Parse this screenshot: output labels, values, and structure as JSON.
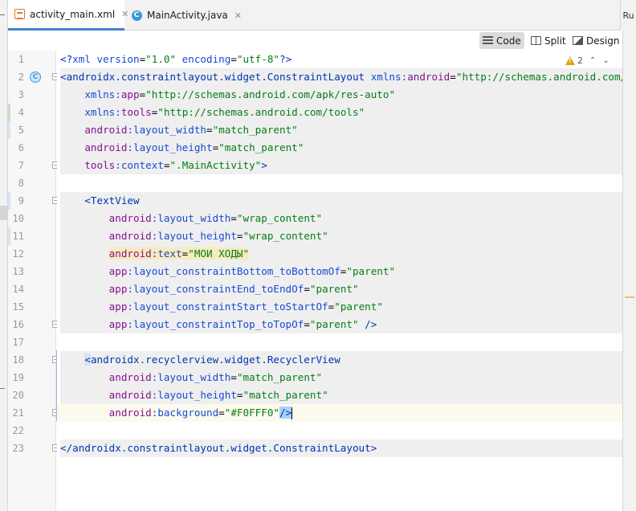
{
  "tabs": [
    {
      "label": "activity_main.xml",
      "icon": "xml-file-icon",
      "active": true,
      "close": "✕"
    },
    {
      "label": "MainActivity.java",
      "icon": "java-class-icon",
      "active": false,
      "close": "✕"
    }
  ],
  "right_strip_label": "Ru",
  "view_modes": {
    "code": "Code",
    "split": "Split",
    "design": "Design",
    "selected": "Code"
  },
  "inspection": {
    "warnings": "2"
  },
  "gutter_icon_letter": "C",
  "line_numbers": [
    "1",
    "2",
    "3",
    "4",
    "5",
    "6",
    "7",
    "8",
    "9",
    "10",
    "11",
    "12",
    "13",
    "14",
    "15",
    "16",
    "17",
    "18",
    "19",
    "20",
    "21",
    "22",
    "23"
  ],
  "code": {
    "l1": {
      "a": "<?",
      "b": "xml version",
      "c": "=",
      "d": "\"1.0\"",
      "e": " encoding",
      "f": "=",
      "g": "\"utf-8\"",
      "h": "?>"
    },
    "l2": {
      "a": "<androidx.constraintlayout.widget.ConstraintLayout ",
      "b": "xmlns:",
      "c": "android",
      "d": "=",
      "e": "\"http://schemas.android.com/apk/res/android\""
    },
    "l3": {
      "a": "xmlns:",
      "b": "app",
      "c": "=",
      "d": "\"http://schemas.android.com/apk/res-auto\""
    },
    "l4": {
      "a": "xmlns:",
      "b": "tools",
      "c": "=",
      "d": "\"http://schemas.android.com/tools\""
    },
    "l5": {
      "a": "android",
      "b": ":layout_width",
      "c": "=",
      "d": "\"match_parent\""
    },
    "l6": {
      "a": "android",
      "b": ":layout_height",
      "c": "=",
      "d": "\"match_parent\""
    },
    "l7": {
      "a": "tools",
      "b": ":context",
      "c": "=",
      "d": "\".MainActivity\"",
      "e": ">"
    },
    "l9": {
      "a": "<TextView"
    },
    "l10": {
      "a": "android",
      "b": ":layout_width",
      "c": "=",
      "d": "\"wrap_content\""
    },
    "l11": {
      "a": "android",
      "b": ":layout_height",
      "c": "=",
      "d": "\"wrap_content\""
    },
    "l12": {
      "a": "android",
      "b": ":text",
      "c": "=",
      "d": "\"МОИ ХОДЫ\""
    },
    "l13": {
      "a": "app",
      "b": ":layout_constraintBottom_toBottomOf",
      "c": "=",
      "d": "\"parent\""
    },
    "l14": {
      "a": "app",
      "b": ":layout_constraintEnd_toEndOf",
      "c": "=",
      "d": "\"parent\""
    },
    "l15": {
      "a": "app",
      "b": ":layout_constraintStart_toStartOf",
      "c": "=",
      "d": "\"parent\""
    },
    "l16": {
      "a": "app",
      "b": ":layout_constraintTop_toTopOf",
      "c": "=",
      "d": "\"parent\"",
      "e": " />"
    },
    "l18": {
      "a": "<",
      "b": "androidx.recyclerview.widget.RecyclerView"
    },
    "l19": {
      "a": "android",
      "b": ":layout_width",
      "c": "=",
      "d": "\"match_parent\""
    },
    "l20": {
      "a": "android",
      "b": ":layout_height",
      "c": "=",
      "d": "\"match_parent\""
    },
    "l21": {
      "a": "android",
      "b": ":background",
      "c": "=",
      "d": "\"#F0FFF0\"",
      "e": "/>"
    },
    "l23": {
      "a": "</androidx.constraintlayout.widget.ConstraintLayout",
      "b": ">"
    }
  },
  "colors": {
    "tag": "#0033b3",
    "namespace": "#871094",
    "attribute": "#174ad4",
    "value": "#067d17",
    "active_tab_underline": "#4083c9",
    "warning": "#e2a300"
  }
}
